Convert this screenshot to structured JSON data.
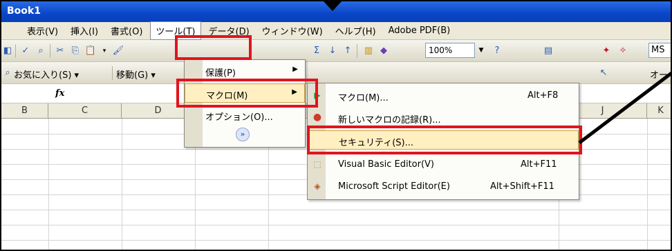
{
  "window": {
    "title": "Book1"
  },
  "menubar": {
    "items": [
      {
        "label": "表示(V)",
        "name": "menu-view"
      },
      {
        "label": "挿入(I)",
        "name": "menu-insert"
      },
      {
        "label": "書式(O)",
        "name": "menu-format"
      },
      {
        "label": "ツール(T)",
        "name": "menu-tools"
      },
      {
        "label": "データ(D)",
        "name": "menu-data"
      },
      {
        "label": "ウィンドウ(W)",
        "name": "menu-window"
      },
      {
        "label": "ヘルプ(H)",
        "name": "menu-help"
      },
      {
        "label": "Adobe PDF(B)",
        "name": "menu-adobe-pdf"
      }
    ]
  },
  "toolbar": {
    "zoom": "100%",
    "font_box": "MS",
    "favorites": "お気に入り(S) ▾",
    "move": "移動(G) ▾",
    "right_partial": "オー"
  },
  "formula_bar": {
    "fx_label": "fx"
  },
  "columns": [
    "B",
    "C",
    "D",
    "J",
    "K"
  ],
  "tools_menu": {
    "items": [
      {
        "label": "保護(P)",
        "has_submenu": true
      },
      {
        "label": "マクロ(M)",
        "has_submenu": true,
        "highlighted": true
      },
      {
        "label": "オプション(O)...",
        "has_submenu": false
      }
    ],
    "expand_icon": "»"
  },
  "macro_menu": {
    "items": [
      {
        "label": "マクロ(M)...",
        "shortcut": "Alt+F8",
        "icon": "play-icon"
      },
      {
        "label": "新しいマクロの記録(R)...",
        "shortcut": "",
        "icon": "record-icon"
      },
      {
        "label": "セキュリティ(S)...",
        "shortcut": "",
        "icon": "",
        "highlighted": true
      },
      {
        "label": "Visual Basic Editor(V)",
        "shortcut": "Alt+F11",
        "icon": "vb-editor-icon"
      },
      {
        "label": "Microsoft Script Editor(E)",
        "shortcut": "Alt+Shift+F11",
        "icon": "script-editor-icon"
      }
    ]
  },
  "colors": {
    "highlight_box": "#e0141e",
    "menu_highlight": "#ffefc1",
    "title_bar": "#0a46c8"
  }
}
